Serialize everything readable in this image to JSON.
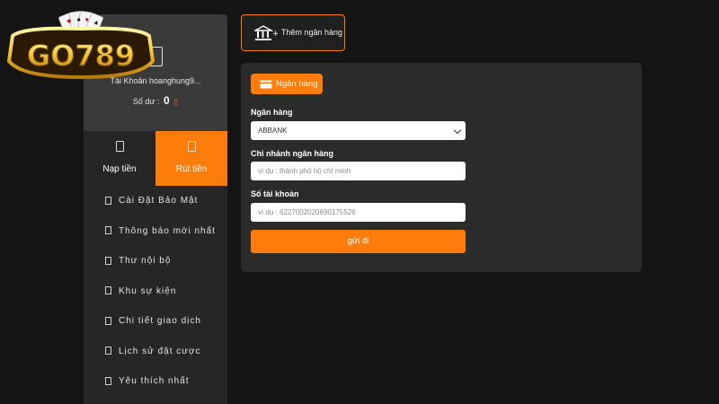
{
  "logo": {
    "text": "GO789"
  },
  "profile": {
    "account_label": "Tài Khoản hoanghung9...",
    "balance_label": "Số dư :",
    "balance_value": "0"
  },
  "tabs": [
    {
      "label": "Nạp tiền",
      "active": false
    },
    {
      "label": "Rút tiền",
      "active": true
    }
  ],
  "menu": [
    {
      "label": "Cài Đặt Bảo Mật"
    },
    {
      "label": "Thông báo mới nhất"
    },
    {
      "label": "Thư nội bộ"
    },
    {
      "label": "Khu sự kiện"
    },
    {
      "label": "Chi tiết giao dịch"
    },
    {
      "label": "Lịch sử đặt cược"
    },
    {
      "label": "Yêu thích nhất"
    }
  ],
  "add_bank_button": {
    "label": "Thêm ngân hàng"
  },
  "form": {
    "tag_label": "Ngân hàng",
    "bank_label": "Ngân hàng",
    "bank_selected": "ABBANK",
    "branch_label": "Chi nhánh ngân hàng",
    "branch_placeholder": "ví dụ : thành phố hồ chí minh",
    "account_label": "Số tài khoản",
    "account_placeholder": "ví dụ : 6227002020690175526",
    "submit_label": "gửi đi"
  },
  "colors": {
    "accent": "#fd7d0c",
    "panel": "#2b2b2b",
    "sidebar": "#262626",
    "background": "#141414"
  }
}
